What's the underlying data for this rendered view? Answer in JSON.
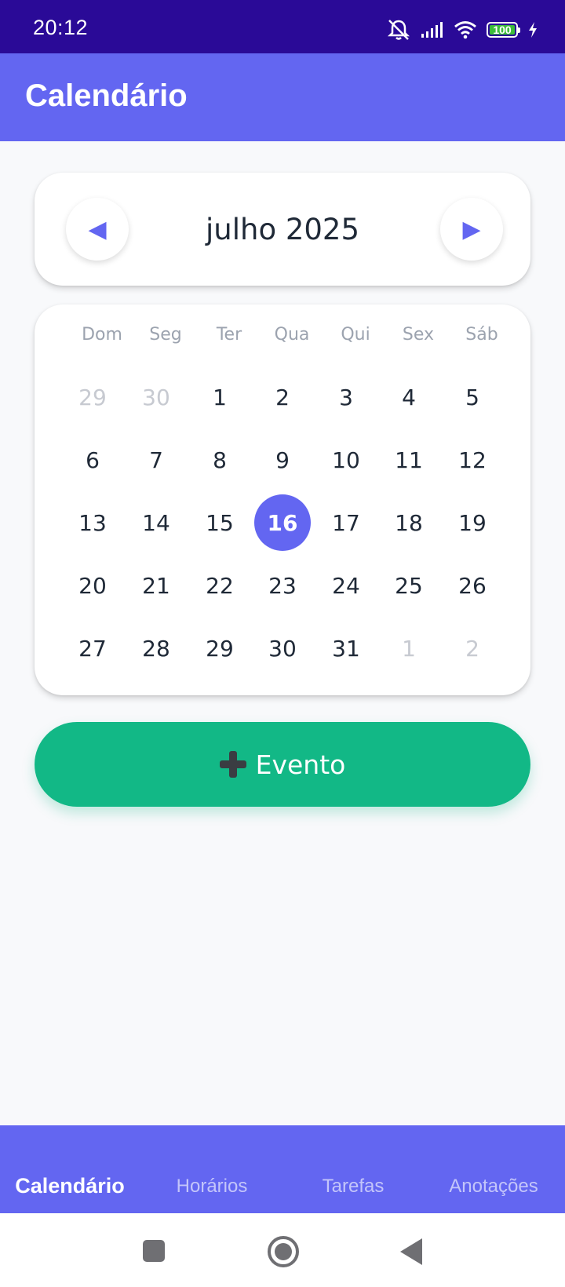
{
  "status_bar": {
    "time": "20:12",
    "icons": [
      "mute-icon",
      "signal-icon",
      "wifi-icon",
      "battery-icon",
      "charging-icon"
    ],
    "battery_level": "100"
  },
  "app_bar": {
    "title": "Calendário"
  },
  "month_nav": {
    "label": "julho 2025",
    "prev_symbol": "◀",
    "next_symbol": "▶"
  },
  "calendar": {
    "weekdays": [
      "Dom",
      "Seg",
      "Ter",
      "Qua",
      "Qui",
      "Sex",
      "Sáb"
    ],
    "weeks": [
      [
        {
          "d": "29",
          "muted": true
        },
        {
          "d": "30",
          "muted": true
        },
        {
          "d": "1"
        },
        {
          "d": "2"
        },
        {
          "d": "3"
        },
        {
          "d": "4"
        },
        {
          "d": "5"
        }
      ],
      [
        {
          "d": "6"
        },
        {
          "d": "7"
        },
        {
          "d": "8"
        },
        {
          "d": "9"
        },
        {
          "d": "10"
        },
        {
          "d": "11"
        },
        {
          "d": "12"
        }
      ],
      [
        {
          "d": "13"
        },
        {
          "d": "14"
        },
        {
          "d": "15"
        },
        {
          "d": "16",
          "selected": true
        },
        {
          "d": "17"
        },
        {
          "d": "18"
        },
        {
          "d": "19"
        }
      ],
      [
        {
          "d": "20"
        },
        {
          "d": "21"
        },
        {
          "d": "22"
        },
        {
          "d": "23"
        },
        {
          "d": "24"
        },
        {
          "d": "25"
        },
        {
          "d": "26"
        }
      ],
      [
        {
          "d": "27"
        },
        {
          "d": "28"
        },
        {
          "d": "29"
        },
        {
          "d": "30"
        },
        {
          "d": "31"
        },
        {
          "d": "1",
          "muted": true
        },
        {
          "d": "2",
          "muted": true
        }
      ]
    ],
    "selected_day": "16"
  },
  "event_button": {
    "icon": "plus-icon",
    "label": "Evento"
  },
  "tabs": [
    {
      "label": "Calendário",
      "active": true
    },
    {
      "label": "Horários",
      "active": false
    },
    {
      "label": "Tarefas",
      "active": false
    },
    {
      "label": "Anotações",
      "active": false
    }
  ],
  "colors": {
    "status_bar": "#2a0a97",
    "primary": "#6366f1",
    "event_button": "#12b886",
    "background": "#f8f9fb",
    "text": "#1f2937",
    "muted_day": "#c7cad1"
  }
}
